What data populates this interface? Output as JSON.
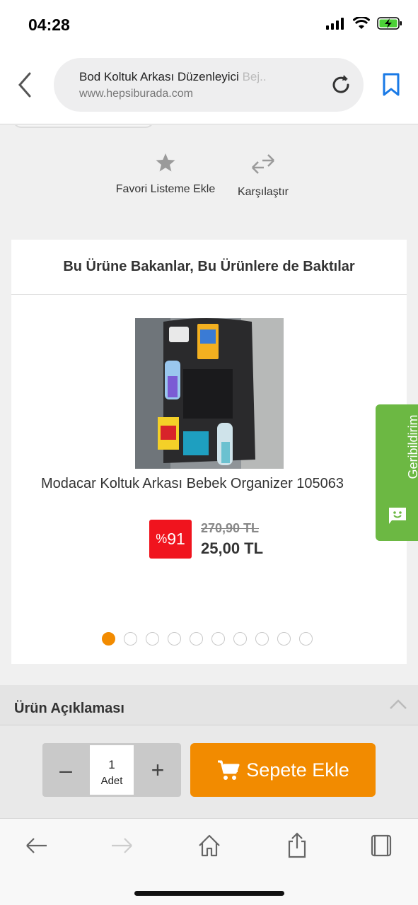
{
  "status_bar": {
    "time": "04:28"
  },
  "browser": {
    "page_title": "Bod Koltuk Arkası Düzenleyici",
    "page_title_fade": "Bej..",
    "domain": "www.hepsiburada.com"
  },
  "actions": {
    "favorite": "Favori Listeme Ekle",
    "compare": "Karşılaştır"
  },
  "recommendations": {
    "title": "Bu Ürüne Bakanlar, Bu Ürünlere de Baktılar",
    "product": {
      "name": "Modacar Koltuk Arkası Bebek Organizer 105063",
      "discount_symbol": "%",
      "discount_value": "91",
      "old_price": "270,90 TL",
      "new_price": "25,00 TL"
    },
    "carousel_total": 10,
    "carousel_active": 0
  },
  "description": {
    "title": "Ürün Açıklaması"
  },
  "cart": {
    "quantity": "1",
    "unit": "Adet",
    "minus": "–",
    "plus": "+",
    "add_label": "Sepete Ekle"
  },
  "feedback": {
    "label": "Geribildirim"
  },
  "colors": {
    "accent": "#f28b00",
    "discount": "#f0141e",
    "feedback": "#6cb843",
    "link": "#1a7ae6"
  }
}
